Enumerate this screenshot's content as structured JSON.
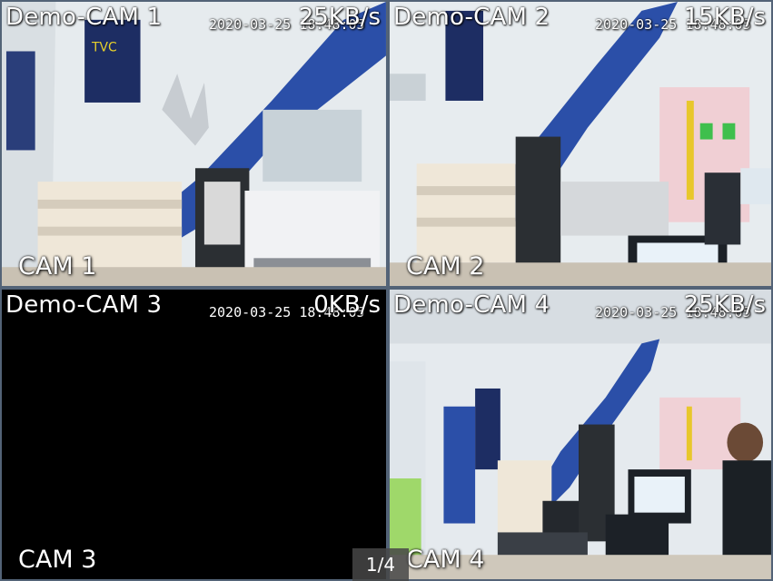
{
  "cameras": [
    {
      "title": "Demo-CAM 1",
      "timestamp": "2020-03-25 18:48:05",
      "bitrate": "25KB/s",
      "label": "CAM 1"
    },
    {
      "title": "Demo-CAM 2",
      "timestamp": "2020-03-25 18:48:05",
      "bitrate": "15KB/s",
      "label": "CAM 2"
    },
    {
      "title": "Demo-CAM 3",
      "timestamp": "2020-03-25 18:48:05",
      "bitrate": "0KB/s",
      "label": "CAM 3"
    },
    {
      "title": "Demo-CAM 4",
      "timestamp": "2020-03-25 18:48:05",
      "bitrate": "25KB/s",
      "label": "CAM 4"
    }
  ],
  "pager": {
    "text": "1/4"
  },
  "colors": {
    "border": "#536377",
    "wall": "#e9eef2",
    "stair_blue": "#2b4fa8",
    "black": "#000000"
  }
}
